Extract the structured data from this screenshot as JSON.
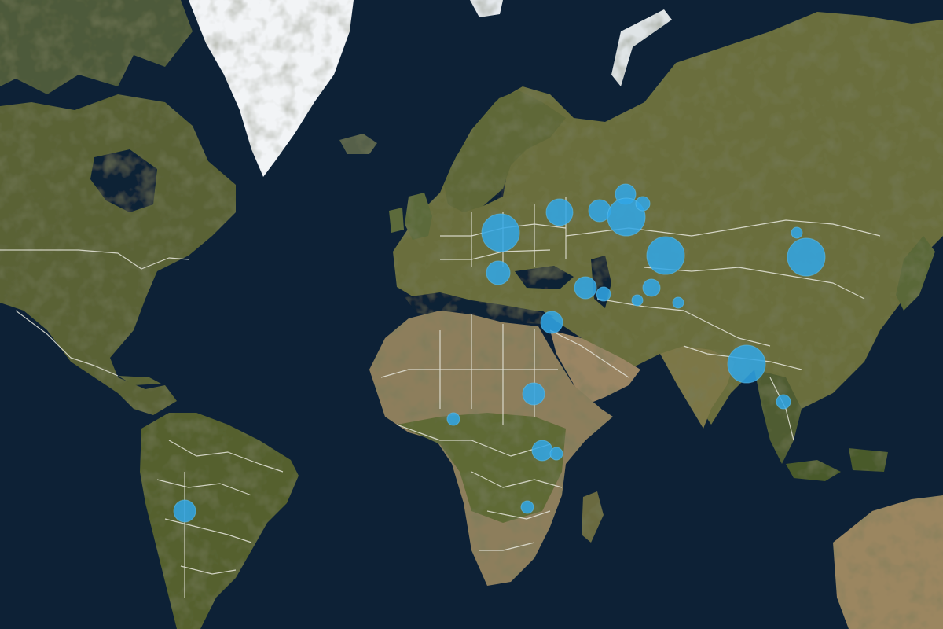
{
  "map": {
    "basemap": "satellite",
    "colors": {
      "ocean": "#0b1a2c",
      "land_dark": "#4b5630",
      "land_mid": "#6f7342",
      "desert": "#8f8160",
      "ice": "#f2f4f6",
      "border": "#e6e6dc",
      "bubble": "#31a7e6"
    },
    "markers": [
      {
        "id": "poland",
        "size": "large"
      },
      {
        "id": "belarus-east",
        "size": "medium"
      },
      {
        "id": "russia-west-a",
        "size": "medium"
      },
      {
        "id": "russia-west-b",
        "size": "small"
      },
      {
        "id": "russia-west-c",
        "size": "large"
      },
      {
        "id": "russia-west-d",
        "size": "tiny"
      },
      {
        "id": "balkans",
        "size": "medium"
      },
      {
        "id": "caucasus",
        "size": "small"
      },
      {
        "id": "caspian",
        "size": "tiny"
      },
      {
        "id": "kazakhstan",
        "size": "large"
      },
      {
        "id": "central-asia-a",
        "size": "small"
      },
      {
        "id": "central-asia-b",
        "size": "tiny"
      },
      {
        "id": "central-asia-c",
        "size": "tiny"
      },
      {
        "id": "levant",
        "size": "small"
      },
      {
        "id": "mongolia",
        "size": "large"
      },
      {
        "id": "baikal",
        "size": "tiny"
      },
      {
        "id": "bangladesh",
        "size": "large"
      },
      {
        "id": "thailand",
        "size": "tiny"
      },
      {
        "id": "sudan",
        "size": "small"
      },
      {
        "id": "nigeria",
        "size": "tiny"
      },
      {
        "id": "great-lakes-a",
        "size": "small"
      },
      {
        "id": "great-lakes-b",
        "size": "tiny"
      },
      {
        "id": "zambia",
        "size": "tiny"
      },
      {
        "id": "bolivia",
        "size": "small"
      }
    ]
  }
}
